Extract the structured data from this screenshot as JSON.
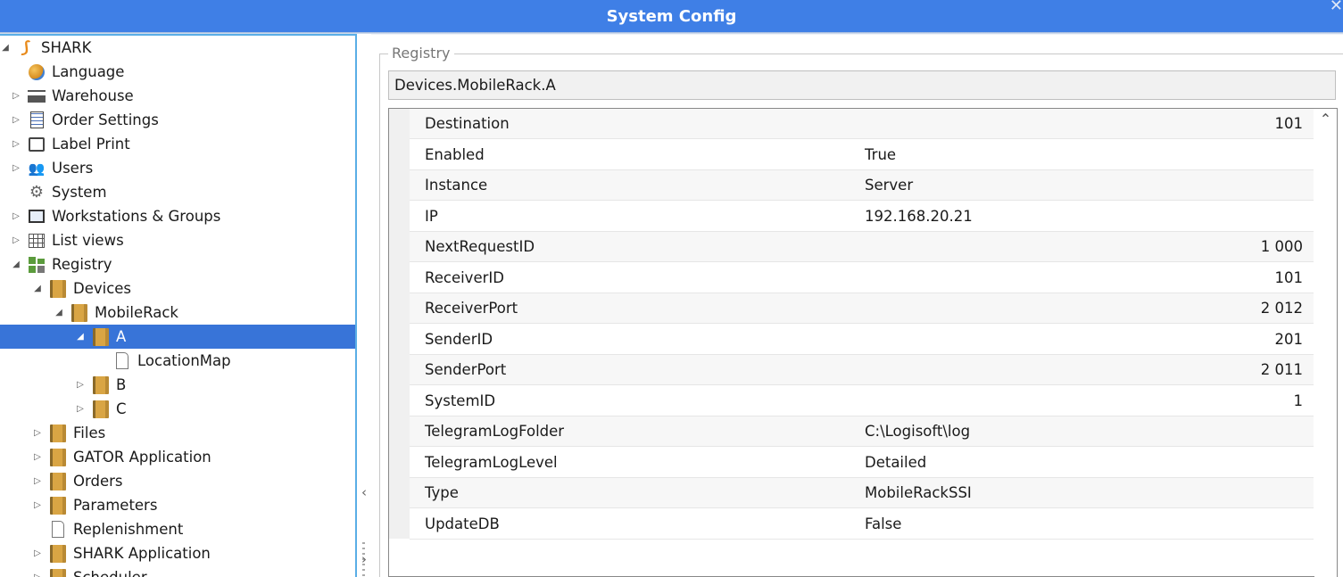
{
  "window": {
    "title": "System Config"
  },
  "tree": {
    "items": [
      {
        "label": "SHARK",
        "icon": "shark-logo-icon",
        "arrow": "expanded"
      },
      {
        "label": "Language",
        "icon": "globe-icon",
        "arrow": ""
      },
      {
        "label": "Warehouse",
        "icon": "factory-icon",
        "arrow": "collapsed"
      },
      {
        "label": "Order Settings",
        "icon": "order-settings-icon",
        "arrow": "collapsed"
      },
      {
        "label": "Label Print",
        "icon": "printer-icon",
        "arrow": "collapsed"
      },
      {
        "label": "Users",
        "icon": "users-icon",
        "arrow": "collapsed"
      },
      {
        "label": "System",
        "icon": "gear-icon",
        "arrow": ""
      },
      {
        "label": "Workstations & Groups",
        "icon": "monitor-icon",
        "arrow": "collapsed"
      },
      {
        "label": "List views",
        "icon": "table-icon",
        "arrow": "collapsed"
      },
      {
        "label": "Registry",
        "icon": "registry-icon",
        "arrow": "expanded"
      },
      {
        "label": "Devices",
        "icon": "folder-icon",
        "arrow": "expanded"
      },
      {
        "label": "MobileRack",
        "icon": "folder-icon",
        "arrow": "expanded"
      },
      {
        "label": "A",
        "icon": "folder-icon",
        "arrow": "expanded",
        "selected": true
      },
      {
        "label": "LocationMap",
        "icon": "document-icon",
        "arrow": ""
      },
      {
        "label": "B",
        "icon": "folder-icon",
        "arrow": "collapsed"
      },
      {
        "label": "C",
        "icon": "folder-icon",
        "arrow": "collapsed"
      },
      {
        "label": "Files",
        "icon": "folder-icon",
        "arrow": "collapsed"
      },
      {
        "label": "GATOR Application",
        "icon": "folder-icon",
        "arrow": "collapsed"
      },
      {
        "label": "Orders",
        "icon": "folder-icon",
        "arrow": "collapsed"
      },
      {
        "label": "Parameters",
        "icon": "folder-icon",
        "arrow": "collapsed"
      },
      {
        "label": "Replenishment",
        "icon": "document-icon",
        "arrow": ""
      },
      {
        "label": "SHARK Application",
        "icon": "folder-icon",
        "arrow": "collapsed"
      },
      {
        "label": "Scheduler",
        "icon": "folder-icon",
        "arrow": "collapsed"
      }
    ]
  },
  "registry": {
    "group_label": "Registry",
    "path": "Devices.MobileRack.A",
    "properties": [
      {
        "name": "Destination",
        "value": "101",
        "align": "right"
      },
      {
        "name": "Enabled",
        "value": "True",
        "align": "left"
      },
      {
        "name": "Instance",
        "value": "Server",
        "align": "left"
      },
      {
        "name": "IP",
        "value": "192.168.20.21",
        "align": "left"
      },
      {
        "name": "NextRequestID",
        "value": "1 000",
        "align": "right"
      },
      {
        "name": "ReceiverID",
        "value": "101",
        "align": "right"
      },
      {
        "name": "ReceiverPort",
        "value": "2 012",
        "align": "right"
      },
      {
        "name": "SenderID",
        "value": "201",
        "align": "right"
      },
      {
        "name": "SenderPort",
        "value": "2 011",
        "align": "right"
      },
      {
        "name": "SystemID",
        "value": "1",
        "align": "right"
      },
      {
        "name": "TelegramLogFolder",
        "value": "C:\\Logisoft\\log",
        "align": "left"
      },
      {
        "name": "TelegramLogLevel",
        "value": "Detailed",
        "align": "left"
      },
      {
        "name": "Type",
        "value": "MobileRackSSI",
        "align": "left"
      },
      {
        "name": "UpdateDB",
        "value": "False",
        "align": "left"
      }
    ]
  },
  "colors": {
    "titlebar": "#3f7fe6",
    "selection": "#3874d8",
    "splitter_border": "#5aaee6"
  }
}
